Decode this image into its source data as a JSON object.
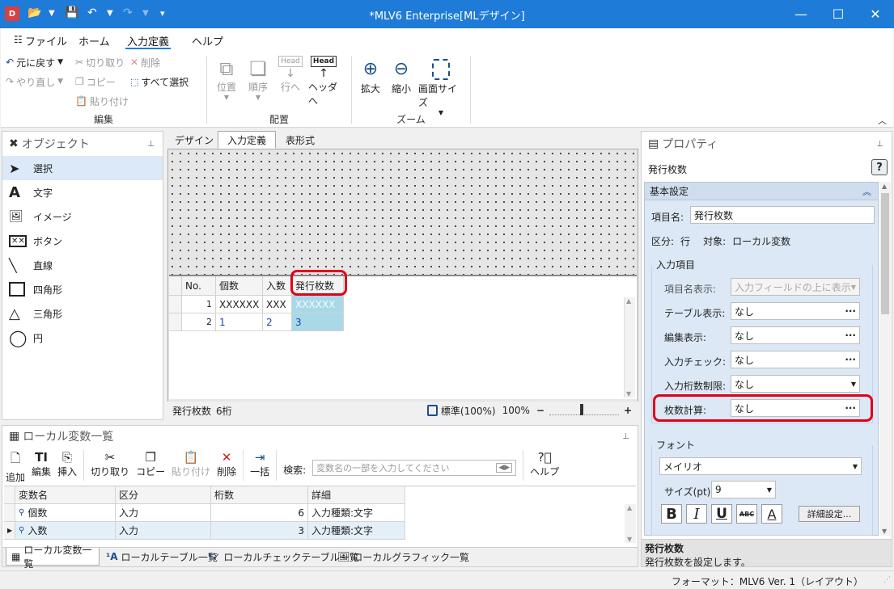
{
  "window": {
    "title": "*MLV6 Enterprise[MLデザイン]"
  },
  "menu": {
    "items": [
      "ファイル",
      "ホーム",
      "入力定義",
      "ヘルプ"
    ]
  },
  "ribbon": {
    "undo": "元に戻す",
    "redo": "やり直し",
    "cut": "切り取り",
    "copy": "コピー",
    "paste": "貼り付け",
    "delete": "削除",
    "select_all": "すべて選択",
    "group_edit": "編集",
    "position": "位置",
    "order": "順序",
    "to_row": "行へ",
    "to_header": "ヘッダへ",
    "group_arrange": "配置",
    "zoom_in": "拡大",
    "zoom_out": "縮小",
    "screen_size": "画面サイズ",
    "group_zoom": "ズーム",
    "head_label": "Head"
  },
  "objects": {
    "title": "オブジェクト",
    "items": [
      "選択",
      "文字",
      "イメージ",
      "ボタン",
      "直線",
      "四角形",
      "三角形",
      "円"
    ]
  },
  "design": {
    "tabs": [
      "デザイン",
      "入力定義",
      "表形式"
    ],
    "grid_headers": [
      "No.",
      "個数",
      "入数",
      "発行枚数"
    ],
    "rows": [
      [
        "1",
        "XXXXXX",
        "XXX",
        "XXXXXX"
      ],
      [
        "2",
        "1",
        "2",
        "3"
      ]
    ],
    "status_left": "発行枚数",
    "status_digits": "6桁",
    "zoom_mode": "標準(100%)",
    "zoom_pct": "100%"
  },
  "locals": {
    "title": "ローカル変数一覧",
    "toolbar": {
      "add": "追加",
      "edit": "編集",
      "insert": "挿入",
      "cut": "切り取り",
      "copy": "コピー",
      "paste": "貼り付け",
      "delete": "削除",
      "batch": "一括",
      "search_label": "検索:",
      "search_placeholder": "変数名の一部を入力してください",
      "help": "ヘルプ"
    },
    "headers": [
      "変数名",
      "区分",
      "桁数",
      "詳細"
    ],
    "rows": [
      [
        "個数",
        "入力",
        "6",
        "入力種類:文字"
      ],
      [
        "入数",
        "入力",
        "3",
        "入力種類:文字"
      ]
    ],
    "tabs": [
      "ローカル変数一覧",
      "ローカルテーブル一覧",
      "ローカルチェックテーブル一覧",
      "ローカルグラフィック一覧"
    ]
  },
  "properties": {
    "title": "プロパティ",
    "subject": "発行枚数",
    "section_basic": "基本設定",
    "item_name_label": "項目名:",
    "item_name_value": "発行枚数",
    "kubun_label": "区分:",
    "kubun_value": "行",
    "target_label": "対象:",
    "target_value": "ローカル変数",
    "input_group": "入力項目",
    "rows": [
      {
        "label": "項目名表示:",
        "value": "入力フィールドの上に表示"
      },
      {
        "label": "テーブル表示:",
        "value": "なし"
      },
      {
        "label": "編集表示:",
        "value": "なし"
      },
      {
        "label": "入力チェック:",
        "value": "なし"
      },
      {
        "label": "入力桁数制限:",
        "value": "なし"
      },
      {
        "label": "枚数計算:",
        "value": "なし"
      }
    ],
    "font_group": "フォント",
    "font_name": "メイリオ",
    "size_label": "サイズ(pt):",
    "size_value": "9",
    "detail_button": "詳細設定...",
    "abc": "ABC",
    "desc_title": "発行枚数",
    "desc_text": "発行枚数を設定します。"
  },
  "statusbar": {
    "format": "フォーマット：MLV6 Ver. 1（レイアウト）"
  },
  "colors": {
    "titlebar": "#1e7bd7",
    "highlight": "#e0001b",
    "selected_cell": "#a9d8e6",
    "panel_blue": "#dce8f5"
  }
}
